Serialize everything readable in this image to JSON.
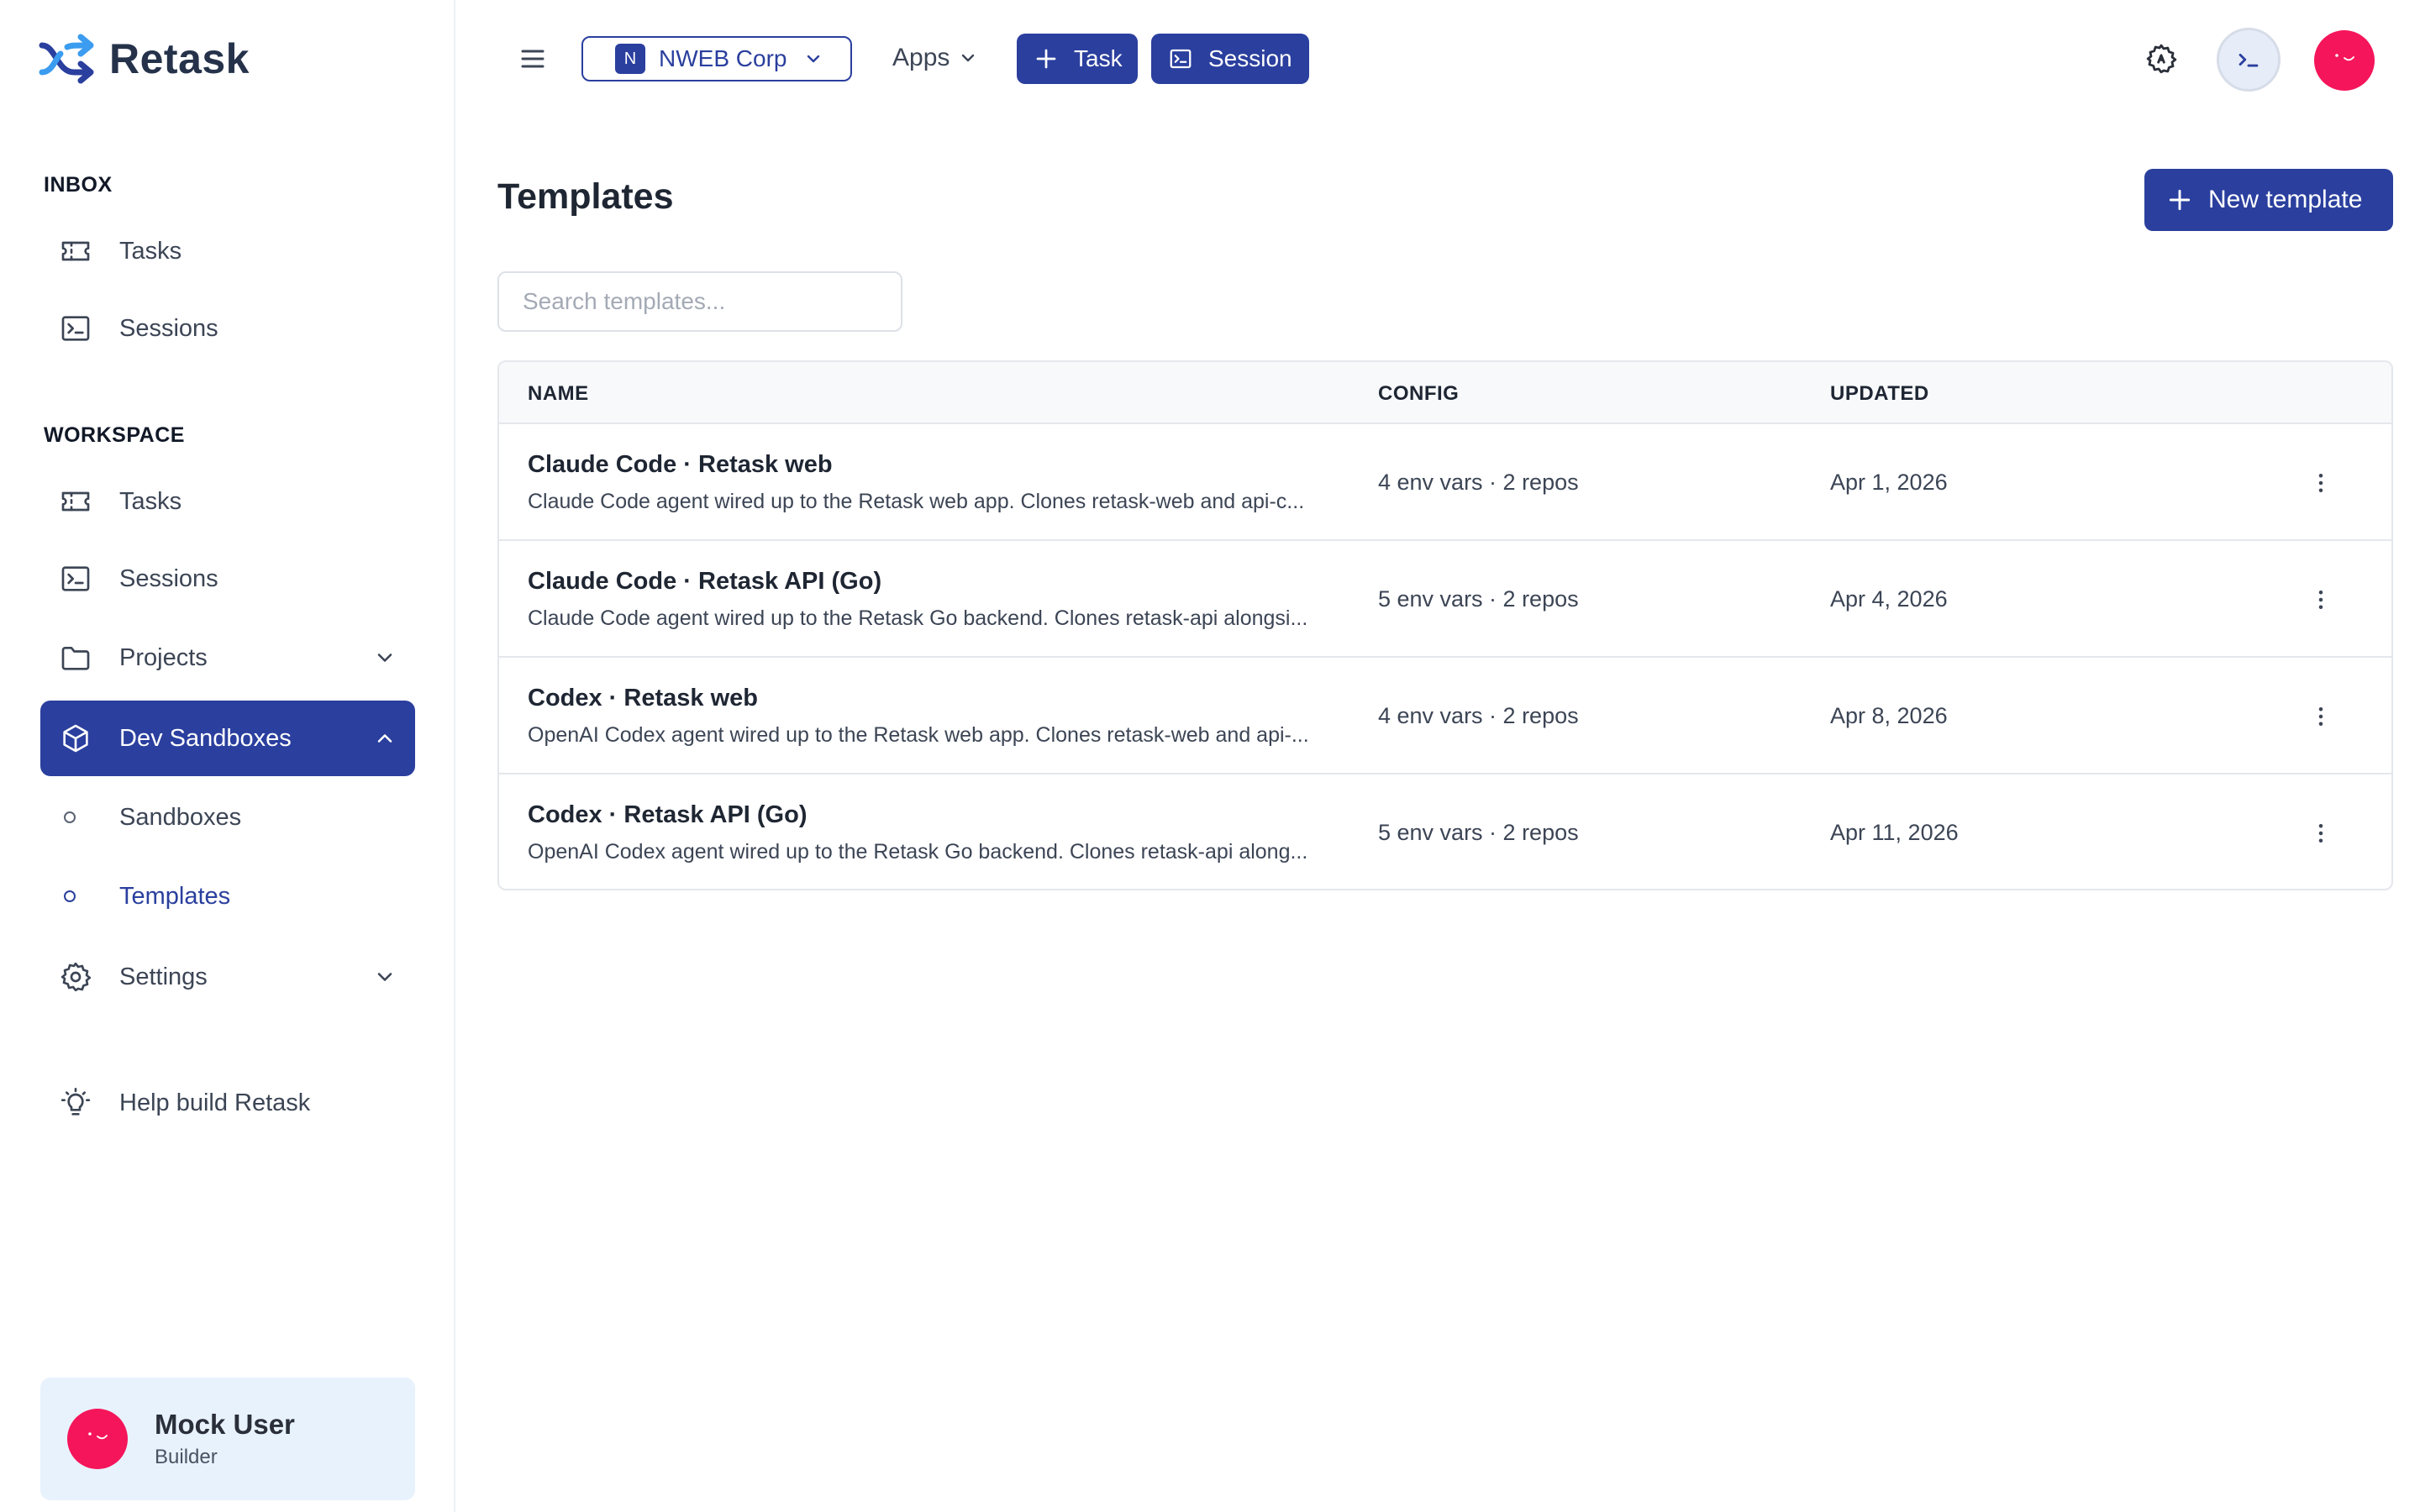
{
  "app": {
    "brand": "Retask"
  },
  "sidebar": {
    "inbox_label": "INBOX",
    "inbox_items": [
      {
        "label": "Tasks",
        "icon": "ticket-icon"
      },
      {
        "label": "Sessions",
        "icon": "terminal-icon"
      }
    ],
    "workspace_label": "WORKSPACE",
    "workspace_items": [
      {
        "label": "Tasks",
        "icon": "ticket-icon"
      },
      {
        "label": "Sessions",
        "icon": "terminal-icon"
      },
      {
        "label": "Projects",
        "icon": "folder-icon",
        "expandable": true
      },
      {
        "label": "Dev Sandboxes",
        "icon": "cube-icon",
        "expanded": true,
        "active": true
      }
    ],
    "sandbox_children": [
      {
        "label": "Sandboxes"
      },
      {
        "label": "Templates",
        "current": true
      }
    ],
    "settings_label": "Settings",
    "help_label": "Help build Retask",
    "user": {
      "name": "Mock User",
      "role": "Builder"
    }
  },
  "topbar": {
    "org_initial": "N",
    "org_name": "NWEB Corp",
    "apps_label": "Apps",
    "task_button": "Task",
    "session_button": "Session"
  },
  "page": {
    "title": "Templates",
    "new_button": "New template",
    "search_placeholder": "Search templates..."
  },
  "table": {
    "columns": [
      "NAME",
      "CONFIG",
      "UPDATED"
    ],
    "rows": [
      {
        "name": "Claude Code · Retask web",
        "description": "Claude Code agent wired up to the Retask web app. Clones retask-web and api-c...",
        "config": "4 env vars · 2 repos",
        "updated": "Apr 1, 2026"
      },
      {
        "name": "Claude Code · Retask API (Go)",
        "description": "Claude Code agent wired up to the Retask Go backend. Clones retask-api alongsi...",
        "config": "5 env vars · 2 repos",
        "updated": "Apr 4, 2026"
      },
      {
        "name": "Codex · Retask web",
        "description": "OpenAI Codex agent wired up to the Retask web app. Clones retask-web and api-...",
        "config": "4 env vars · 2 repos",
        "updated": "Apr 8, 2026"
      },
      {
        "name": "Codex · Retask API (Go)",
        "description": "OpenAI Codex agent wired up to the Retask Go backend. Clones retask-api along...",
        "config": "5 env vars · 2 repos",
        "updated": "Apr 11, 2026"
      }
    ]
  },
  "colors": {
    "accent": "#2a3f9e",
    "avatar": "#f5155a",
    "user_card_bg": "#e8f2fd"
  }
}
